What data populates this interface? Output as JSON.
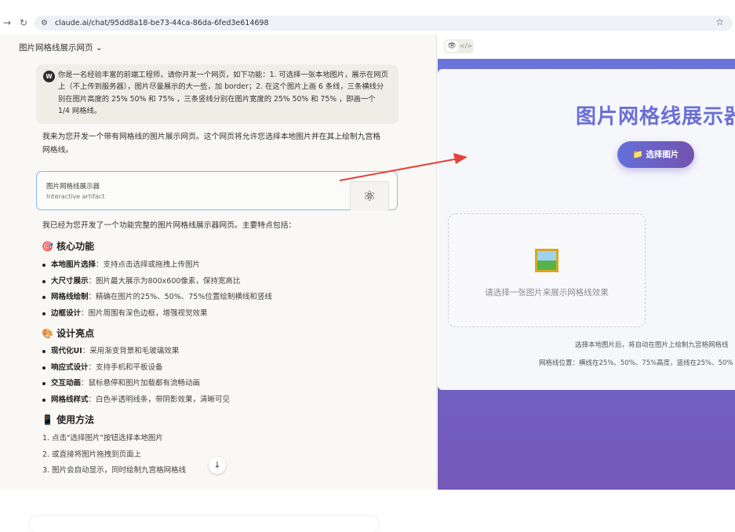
{
  "browser": {
    "url": "claude.ai/chat/95dd8a18-be73-44ca-86da-6fed3e614698"
  },
  "chat": {
    "title": "图片网格线展示网页",
    "user_avatar": "W",
    "user_message": "你是一名经验丰富的前端工程师，请你开发一个网页，如下功能：1. 可选择一张本地图片，展示在网页上（不上传到服务器），图片尽量展示的大一些，加 border；2. 在这个图片上画 6 条线，三条横线分别在图片高度的 25% 50% 和 75% ，三条竖线分别在图片宽度的 25% 50% 和 75% ，即画一个 1/4 网格线。",
    "reply_intro": "我来为您开发一个带有网格线的图片展示网页。这个网页将允许您选择本地图片并在其上绘制九宫格网格线。",
    "artifact": {
      "title": "图片网格线展示器",
      "subtitle": "Interactive artifact"
    },
    "reply_summary": "我已经为您开发了一个功能完整的图片网格线展示器网页。主要特点包括：",
    "sections": [
      {
        "emoji": "🎯",
        "title": "核心功能",
        "items": [
          {
            "bold": "本地图片选择",
            "text": "：支持点击选择或拖拽上传图片"
          },
          {
            "bold": "大尺寸展示",
            "text": "：图片最大展示为800x600像素，保持宽高比"
          },
          {
            "bold": "网格线绘制",
            "text": "：精确在图片的25%、50%、75%位置绘制横线和竖线"
          },
          {
            "bold": "边框设计",
            "text": "：图片周围有深色边框，增强视觉效果"
          }
        ]
      },
      {
        "emoji": "🎨",
        "title": "设计亮点",
        "items": [
          {
            "bold": "现代化UI",
            "text": "：采用渐变背景和毛玻璃效果"
          },
          {
            "bold": "响应式设计",
            "text": "：支持手机和平板设备"
          },
          {
            "bold": "交互动画",
            "text": "：鼠标悬停和图片加载都有流畅动画"
          },
          {
            "bold": "网格线样式",
            "text": "：白色半透明线条，带阴影效果，清晰可见"
          }
        ]
      }
    ],
    "usage": {
      "emoji": "📱",
      "title": "使用方法",
      "steps": [
        "1. 点击\"选择图片\"按钮选择本地图片",
        "2. 或直接将图片拖拽到页面上",
        "3. 图片会自动显示，同时绘制九宫格网格线"
      ]
    }
  },
  "preview": {
    "title": "图片网格线展示器",
    "choose_button": "选择图片",
    "choose_icon": "📁",
    "placeholder": "请选择一张图片来展示网格线效果",
    "info1": "选择本地图片后，将自动在图片上绘制九宫格网格线",
    "info2": "网格线位置：横线在25%、50%、75%高度，竖线在25%、50%"
  },
  "colors": {
    "accent": "#6a6fd6",
    "annotation_arrow": "#e8413a"
  }
}
